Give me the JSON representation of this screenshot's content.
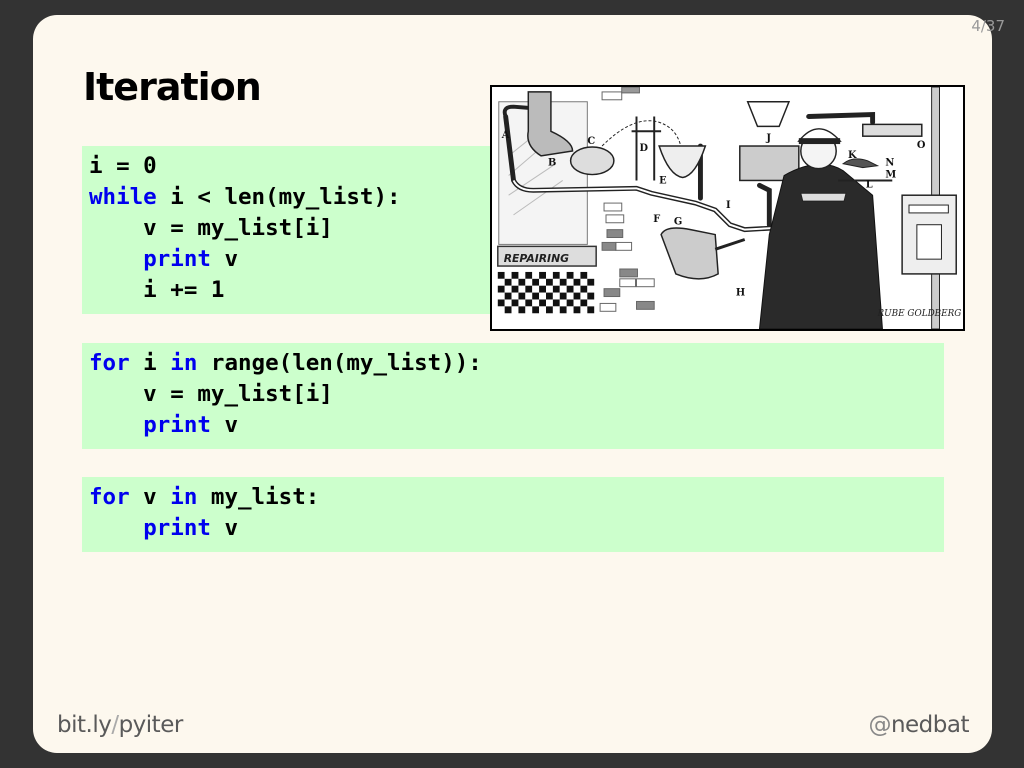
{
  "slide": {
    "counter": "4/37",
    "title": "Iteration",
    "code_blocks": [
      {
        "lines": [
          [
            {
              "t": "i = 0",
              "k": false
            }
          ],
          [
            {
              "t": "while",
              "k": true
            },
            {
              "t": " i < len(my_list):",
              "k": false
            }
          ],
          [
            {
              "t": "    v = my_list[i]",
              "k": false
            }
          ],
          [
            {
              "t": "    ",
              "k": false
            },
            {
              "t": "print",
              "k": true
            },
            {
              "t": " v",
              "k": false
            }
          ],
          [
            {
              "t": "    i += 1",
              "k": false
            }
          ]
        ]
      },
      {
        "lines": [
          [
            {
              "t": "for",
              "k": true
            },
            {
              "t": " i ",
              "k": false
            },
            {
              "t": "in",
              "k": true
            },
            {
              "t": " range(len(my_list)):",
              "k": false
            }
          ],
          [
            {
              "t": "    v = my_list[i]",
              "k": false
            }
          ],
          [
            {
              "t": "    ",
              "k": false
            },
            {
              "t": "print",
              "k": true
            },
            {
              "t": " v",
              "k": false
            }
          ]
        ]
      },
      {
        "lines": [
          [
            {
              "t": "for",
              "k": true
            },
            {
              "t": " v ",
              "k": false
            },
            {
              "t": "in",
              "k": true
            },
            {
              "t": " my_list:",
              "k": false
            }
          ],
          [
            {
              "t": "    ",
              "k": false
            },
            {
              "t": "print",
              "k": true
            },
            {
              "t": " v",
              "k": false
            }
          ]
        ]
      }
    ],
    "illustration": {
      "description": "Rube Goldberg machine cartoon",
      "labels": [
        "A",
        "B",
        "C",
        "D",
        "E",
        "F",
        "G",
        "H",
        "I",
        "J",
        "K",
        "L",
        "M",
        "N",
        "O"
      ],
      "sign_text": "REPAIRING",
      "signature": "RUBE GOLDBERG"
    },
    "footer": {
      "link_host": "bit.ly",
      "link_sep": "/",
      "link_path": "pyiter",
      "handle_at": "@",
      "handle_name": "nedbat"
    }
  },
  "colors": {
    "background": "#333333",
    "slide": "#fdf8ee",
    "code_bg": "#ccffcc",
    "keyword": "#0000ee",
    "footer_text": "#5a5a5a"
  }
}
